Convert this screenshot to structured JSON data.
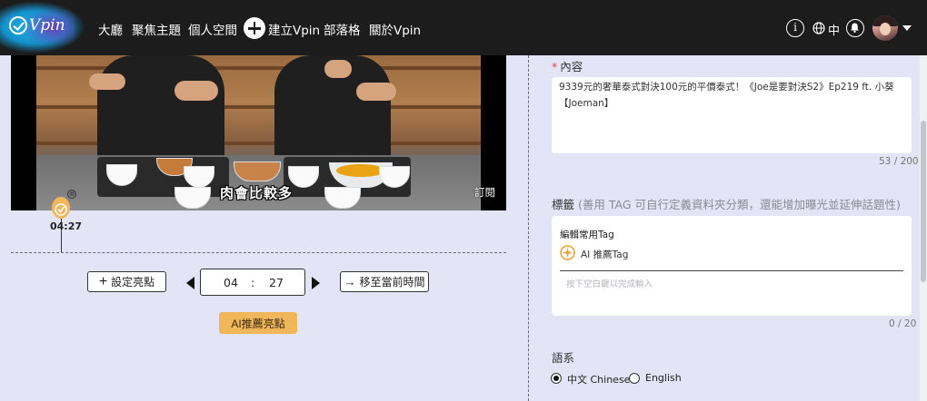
{
  "nav": {
    "logo_text": "Vpin",
    "links": [
      "大廳",
      "聚焦主題",
      "個人空間"
    ],
    "create_label": "建立Vpin",
    "links_right": [
      "部落格",
      "關於Vpin"
    ],
    "info_icon": "i",
    "language": "中",
    "icons": [
      "info-icon",
      "globe-icon",
      "bell-icon",
      "avatar",
      "chevron-down-icon"
    ]
  },
  "video": {
    "subtitle": "肉會比較多",
    "subscribe_label": "訂閱"
  },
  "marker": {
    "time": "04:27",
    "close_glyph": "⊗"
  },
  "controls": {
    "set_highlight_label": "設定亮點",
    "minutes": "04",
    "separator": ":",
    "seconds": "27",
    "move_to_current_label": "移至當前時間",
    "ai_recommend_label": "AI推薦亮點"
  },
  "content": {
    "label": "內容",
    "required_mark": "*",
    "text_line1": "9339元的奢華泰式對決100元的平價泰式！《Joe是要對決S2》Ep219 ft. 小葵",
    "text_line2": "【Joeman】",
    "counter": "53 / 200"
  },
  "tags": {
    "label": "標籤",
    "hint": "(善用 TAG 可自行定義資料夾分類，還能增加曝光並延伸話題性)",
    "edit_common": "編輯常用Tag",
    "ai_tag": "AI 推薦Tag",
    "input_placeholder": "按下空白鍵以完成輸入",
    "counter": "0 / 20"
  },
  "language": {
    "label": "語系",
    "options": [
      {
        "label": "中文 Chinese",
        "selected": true
      },
      {
        "label": "English",
        "selected": false
      }
    ]
  },
  "colors": {
    "nav_bg": "#1c1c1c",
    "page_bg": "#e3e4f5",
    "accent_orange": "#f0b65a",
    "required_red": "#e0474c"
  }
}
